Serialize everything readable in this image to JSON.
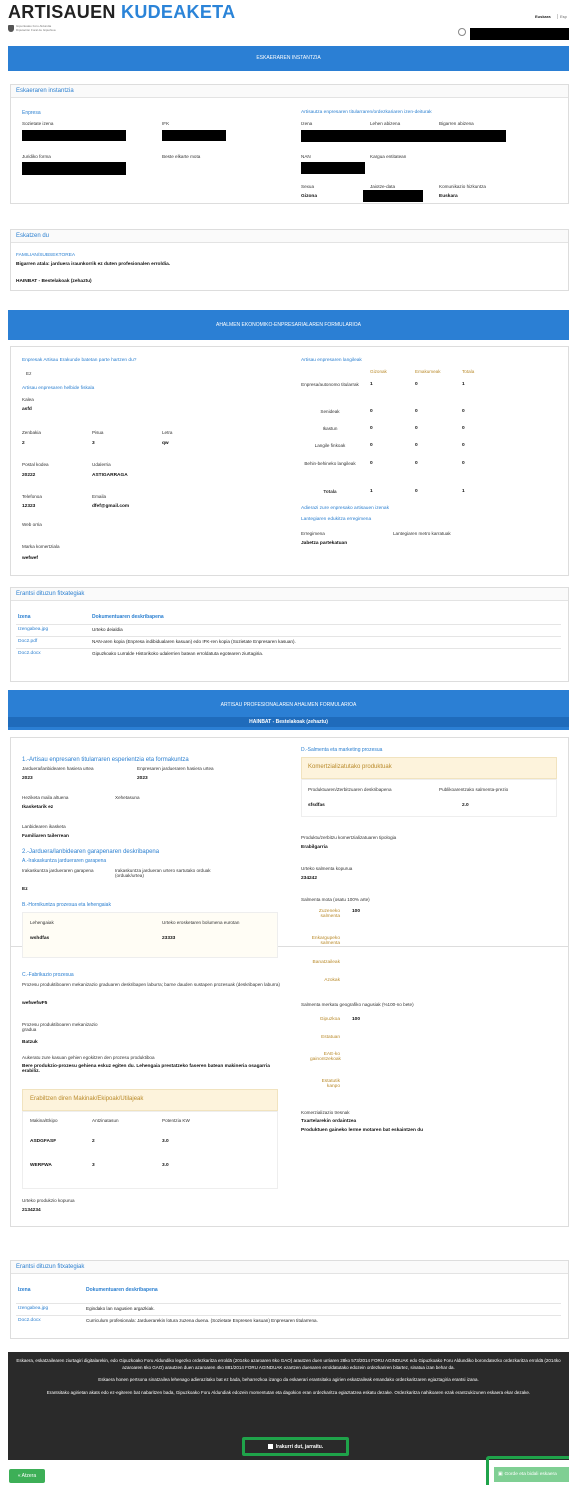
{
  "header": {
    "brand_a": "ARTISAUEN",
    "brand_b": "KUDEAKETA",
    "logo_line1": "Gipuzkoako Foru Aldundia",
    "logo_line2": "Diputación Foral de Gipuzkoa",
    "lang_eu": "Euskara",
    "lang_es": "Esp"
  },
  "band1": "ESKAERAREN INSTANTZIA",
  "p1": {
    "title": "Eskaeraren instantzia",
    "empresa": "Enpresa",
    "sozietate": "Sozietate izena",
    "ifk": "IFK",
    "juridiko": "Juridiko forma",
    "beste": "Beste elkarte mota",
    "titular": "Artisautza enpresaren titularraren/ordezkariaren izen-deiturak",
    "izena": "Izena",
    "lehen": "Lehen abizena",
    "bigarren": "Bigarren abizena",
    "nan": "NAN",
    "kargua": "Kargua entitatean",
    "sexua": "Sexua",
    "jaiotze": "Jaiotze-data",
    "komunikazio": "Komunikazio hizkuntza",
    "sexua_v": "Gizona",
    "hizkuntza_v": "Euskara"
  },
  "p2": {
    "title": "Eskatzen du",
    "fam": "FAMILIAN/SUBSEKTOREA",
    "line1": "Bigarren atala: jarduera iraunkorrik ez duten profesionalen erroldia.",
    "line2": "HAINBAT - Bestelakoak (zehaztu)"
  },
  "band2": "AHALMEN EKONOMIKO-ENPRESARIALAREN FORMULARIOA",
  "p3": {
    "q1": "Enpresak Artisau Erakunde batetan parte hartzen du?",
    "q1v": "Ez",
    "helb": "Artisau enpresaren helbide fiskala",
    "kalea": "Kalea",
    "kalea_v": "asfd",
    "zenb": "Zenbakia",
    "zenb_v": "2",
    "pisua": "Pisua",
    "pisua_v": "3",
    "letra": "Letra",
    "letra_v": "qw",
    "pk": "Postal kodea",
    "pk_v": "20222",
    "udal": "Udalerria",
    "udal_v": "ASTIGARRAGA",
    "tel": "Telefonoa",
    "tel_v": "12323",
    "emaila": "Emaila",
    "emaila_v": "dfef@gmail.com",
    "web": "Web orria",
    "marka": "Marka komertziala",
    "marka_v": "wefwef",
    "lang_title": "Artisau enpresaren langileak",
    "cols": [
      "Gizonak",
      "Emakumeak",
      "Totala"
    ],
    "rows": [
      {
        "l": "Enpresa/autonomo titularrak",
        "v": [
          "1",
          "0",
          "1"
        ]
      },
      {
        "l": "Senideak",
        "v": [
          "0",
          "0",
          "0"
        ]
      },
      {
        "l": "Ikastun",
        "v": [
          "0",
          "0",
          "0"
        ]
      },
      {
        "l": "Langile finkoak",
        "v": [
          "0",
          "0",
          "0"
        ]
      },
      {
        "l": "Behin-behineko langileak",
        "v": [
          "0",
          "0",
          "0"
        ]
      },
      {
        "l": "Totala",
        "v": [
          "1",
          "0",
          "1"
        ]
      }
    ],
    "adierazi": "Adierazi zure enpresako artisauen izenak",
    "lantegi": "Lantegiaren edukitza erregimena",
    "erreg": "Erregimena",
    "metro": "Lantegiaren metro karratuak",
    "erreg_v": "Jabetza partekatuan"
  },
  "p4": {
    "title": "Erantsi dituzun fitxategiak",
    "h1": "Izena",
    "h2": "Dokumentuaren deskribapena",
    "files": [
      {
        "n": "Izengabea.jpg",
        "d": "Urteko deialdia"
      },
      {
        "n": "Doc2.pdf",
        "d": "NAN-aren kopia (Enpresa indibidualaren kasuan) edo IFK-ren kopia (Sozietate Enpresaren kasuan)."
      },
      {
        "n": "Doc2.docx",
        "d": "Gipuzkoako Lurralde Historikoko udalerrien batean erroldatuta egotearen ziurtagiria."
      }
    ]
  },
  "band3": "ARTISAU PROFESIONALAREN AHALMEN FORMULARIOA",
  "band3b": "HAINBAT - Bestelakoak (zehaztu)",
  "p5": {
    "s1": "1.-Artisau enpresaren titularraren esperientzia eta formakuntza",
    "hasiera": "Jarduera/lanbidearen hasiera urtea",
    "hasiera_v": "2023",
    "enp_hasiera": "Enpresaren jardueraren hasiera urtea",
    "enp_hasiera_v": "2023",
    "heziketa": "Heziketa maila altuena",
    "heziketa_v": "Ikasketarik ez",
    "xehe": "Xehetasuna",
    "lanbide": "Lanbidearen ikasketa",
    "lanbide_v": "Familiaren tailerrean",
    "s2": "2.-Jarduera/lanbidearen garapenaren deskribapena",
    "s2a": "A.-Irakaskuntza jardueraren garapena",
    "irak": "Irakaskuntza jardueraren garapena",
    "irak_v": "Ez",
    "irak2": "Irakaskuntza jardueran urtero sartutako orduak (orduak/urtea)",
    "s2b": "B.-Hornikuntza prozesua eta lehengaiak",
    "lehen": "Lehengaiak",
    "erosk": "Urteko erosketaren bolumena eurotan",
    "lehen_v": "wshdfas",
    "erosk_v": "23333",
    "s2c": "C.-Fabrikazio prozesua",
    "fab1": "Prozesu produktiboaren mekanizazio graduaren deskribapen laburra; barne dauden sustapen prozesuak (deskribapen laburra)",
    "fab1_v": "wefwefwF5",
    "fab2": "Prozesu produktiboaren mekanizazio gradua",
    "fab2_v": "Batzuk",
    "auker": "Aukeratu zure kasuan gehien egokitzen den prozesu produktiboa",
    "auker_v": "Bere produkzio-prozesu gehiena eskuz egiten du. Lehengaia prestatzeko faseren batean makineria osagarria erabiliz.",
    "mak_title": "Erabiltzen diren Makinak/Ekipoak/Utilajeak",
    "mk_h": [
      "Makina/Ekipo",
      "Antzinatasun",
      "Potentzia KW"
    ],
    "mk_rows": [
      [
        "ASDGFASF",
        "2",
        "3.0"
      ],
      [
        "WERFWA",
        "3",
        "3.0"
      ]
    ],
    "urteko": "Urteko produkzio kopurua",
    "urteko_v": "2134234",
    "sD": "D.-Salmenta eta marketing prozesua",
    "kom_title": "Komertzializatutako produktuak",
    "prod": "Produktuaren/Zerbitzuaren deskribapena",
    "prezio": "Publikoarentzako salmenta-prezio",
    "prod_v": "sfsdfas",
    "prezio_v": "2.0",
    "tipo": "Produktu/zerbitzu komertzializatuaren tipologia",
    "tipo_v": "Erabilgarria",
    "salkop": "Urteko salmenta kopurua",
    "salkop_v": "234242",
    "salmota": "Salmenta mota (osatu 100% arte)",
    "m1": "Zuzeneko salmenta",
    "m1v": "100",
    "m2": "Enkargupeko salmenta",
    "m3": "Banatzaileak",
    "m4": "Azokak",
    "merk": "Salmenta merkatu geografiko nagusiak (%100-no bete)",
    "g1": "Gipuzkoa",
    "g1v": "100",
    "g2": "Estatuan",
    "g3": "EAE-ko gainontzekoak",
    "g4": "Estatutik kanpo",
    "tresna": "Komerzializazio tresnak",
    "tresna_v1": "Txartelarekin ordaintzea",
    "tresna_v2": "Produktuen gaineko lerme motaren bat eskaintzen du"
  },
  "p6": {
    "title": "Erantsi dituzun fitxategiak",
    "h1": "Izena",
    "h2": "Dokumentuaren deskribapena",
    "files": [
      {
        "n": "Izengabea.jpg",
        "d": "Egindako lan nagusien argazkiak."
      },
      {
        "n": "Doc2.docx",
        "d": "Curriculum profesionala: Jarduerarekin lotura zuzena duena. (Sozietate Enpresen kasuan) Enpresaren titularrena."
      }
    ]
  },
  "legal": {
    "p1": "Eskaera, eskatzailearen ziurtagiri digitalarekin, edo Gipuzkoako Foru Aldundiko legezko ordezkaritza erroldā (2014ko azaroaren 6ko GAO) arautzen duen urriaren 28ko 573/2014 FORU AGINDUAK edo Gipuzkoako Foru Aldundiko borondatezko ordezkaritza erroldā (2014ko azaroaren 6ko GAO) arautzen duen azaroaren 4ko 881/2014 FORU AGINDUAK ezartzen duenaren erroldatutako edozein ordezkariren bitartez, sinatua izan behar da.",
    "p2": "Eskaera honen pertsona sinatzailea lehenago adierazitako bat ez bada, beharrezkoa izango da eskaerari erantsitako agirien eskatzaileak emandako ordezkaritzaren egiaztagiria erantsi izana.",
    "p3": "Erantsitako agirietan akats edo ez-egiteren bat nabaritzen bada, Gipuzkoako Foru Aldundiak edozein momentutan eta dagokion eran ordezkaritza egiaztatzea eskatu dezake. Ordezkaritza nahikoaren ezak erantzukizunen eskaera ekar dezake.",
    "check": "Irakurri dut, jarraitu."
  },
  "footer": {
    "back": "Atzera",
    "save": "Gorde eta bidali eskaera"
  }
}
